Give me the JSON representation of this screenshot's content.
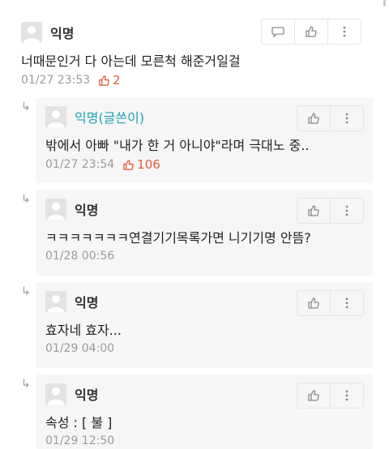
{
  "comments": [
    {
      "author": "익명",
      "text": "너때문인거 다 아는데 모른척 해준거일걸",
      "time": "01/27 23:53",
      "likes": "2"
    }
  ],
  "replies": [
    {
      "author": "익명(글쓴이)",
      "text": "밖에서 아빠 \"내가 한 거 아니야\"라며 극대노 중..",
      "time": "01/27 23:54",
      "likes": "106"
    },
    {
      "author": "익명",
      "text": "ㅋㅋㅋㅋㅋㅋㅋ연결기기목록가면 니기기명 안뜸?",
      "time": "01/28 00:56"
    },
    {
      "author": "익명",
      "text": "효자네 효자...",
      "time": "01/29 04:00"
    },
    {
      "author": "익명",
      "text": "속성 : [ 불 ]",
      "time": "01/29 12:50"
    }
  ],
  "icons": {
    "reply": "reply-arrow-icon",
    "comment": "speech-bubble-icon",
    "like": "thumbs-up-icon",
    "more": "more-vertical-icon",
    "avatar": "default-avatar-icon"
  },
  "colors": {
    "like_count": "#e05b38",
    "author_label": "#1aa3b8",
    "reply_bg": "#f6f6f6"
  }
}
